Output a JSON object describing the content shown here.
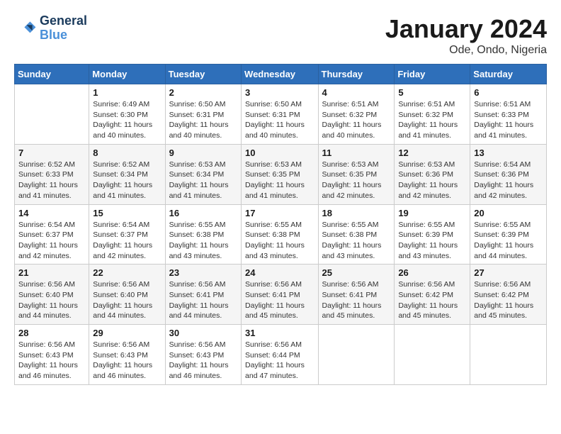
{
  "header": {
    "logo_text_general": "General",
    "logo_text_blue": "Blue",
    "month_title": "January 2024",
    "location": "Ode, Ondo, Nigeria"
  },
  "weekdays": [
    "Sunday",
    "Monday",
    "Tuesday",
    "Wednesday",
    "Thursday",
    "Friday",
    "Saturday"
  ],
  "weeks": [
    [
      {
        "day": "",
        "sunrise": "",
        "sunset": "",
        "daylight": ""
      },
      {
        "day": "1",
        "sunrise": "Sunrise: 6:49 AM",
        "sunset": "Sunset: 6:30 PM",
        "daylight": "Daylight: 11 hours and 40 minutes."
      },
      {
        "day": "2",
        "sunrise": "Sunrise: 6:50 AM",
        "sunset": "Sunset: 6:31 PM",
        "daylight": "Daylight: 11 hours and 40 minutes."
      },
      {
        "day": "3",
        "sunrise": "Sunrise: 6:50 AM",
        "sunset": "Sunset: 6:31 PM",
        "daylight": "Daylight: 11 hours and 40 minutes."
      },
      {
        "day": "4",
        "sunrise": "Sunrise: 6:51 AM",
        "sunset": "Sunset: 6:32 PM",
        "daylight": "Daylight: 11 hours and 40 minutes."
      },
      {
        "day": "5",
        "sunrise": "Sunrise: 6:51 AM",
        "sunset": "Sunset: 6:32 PM",
        "daylight": "Daylight: 11 hours and 41 minutes."
      },
      {
        "day": "6",
        "sunrise": "Sunrise: 6:51 AM",
        "sunset": "Sunset: 6:33 PM",
        "daylight": "Daylight: 11 hours and 41 minutes."
      }
    ],
    [
      {
        "day": "7",
        "sunrise": "Sunrise: 6:52 AM",
        "sunset": "Sunset: 6:33 PM",
        "daylight": "Daylight: 11 hours and 41 minutes."
      },
      {
        "day": "8",
        "sunrise": "Sunrise: 6:52 AM",
        "sunset": "Sunset: 6:34 PM",
        "daylight": "Daylight: 11 hours and 41 minutes."
      },
      {
        "day": "9",
        "sunrise": "Sunrise: 6:53 AM",
        "sunset": "Sunset: 6:34 PM",
        "daylight": "Daylight: 11 hours and 41 minutes."
      },
      {
        "day": "10",
        "sunrise": "Sunrise: 6:53 AM",
        "sunset": "Sunset: 6:35 PM",
        "daylight": "Daylight: 11 hours and 41 minutes."
      },
      {
        "day": "11",
        "sunrise": "Sunrise: 6:53 AM",
        "sunset": "Sunset: 6:35 PM",
        "daylight": "Daylight: 11 hours and 42 minutes."
      },
      {
        "day": "12",
        "sunrise": "Sunrise: 6:53 AM",
        "sunset": "Sunset: 6:36 PM",
        "daylight": "Daylight: 11 hours and 42 minutes."
      },
      {
        "day": "13",
        "sunrise": "Sunrise: 6:54 AM",
        "sunset": "Sunset: 6:36 PM",
        "daylight": "Daylight: 11 hours and 42 minutes."
      }
    ],
    [
      {
        "day": "14",
        "sunrise": "Sunrise: 6:54 AM",
        "sunset": "Sunset: 6:37 PM",
        "daylight": "Daylight: 11 hours and 42 minutes."
      },
      {
        "day": "15",
        "sunrise": "Sunrise: 6:54 AM",
        "sunset": "Sunset: 6:37 PM",
        "daylight": "Daylight: 11 hours and 42 minutes."
      },
      {
        "day": "16",
        "sunrise": "Sunrise: 6:55 AM",
        "sunset": "Sunset: 6:38 PM",
        "daylight": "Daylight: 11 hours and 43 minutes."
      },
      {
        "day": "17",
        "sunrise": "Sunrise: 6:55 AM",
        "sunset": "Sunset: 6:38 PM",
        "daylight": "Daylight: 11 hours and 43 minutes."
      },
      {
        "day": "18",
        "sunrise": "Sunrise: 6:55 AM",
        "sunset": "Sunset: 6:38 PM",
        "daylight": "Daylight: 11 hours and 43 minutes."
      },
      {
        "day": "19",
        "sunrise": "Sunrise: 6:55 AM",
        "sunset": "Sunset: 6:39 PM",
        "daylight": "Daylight: 11 hours and 43 minutes."
      },
      {
        "day": "20",
        "sunrise": "Sunrise: 6:55 AM",
        "sunset": "Sunset: 6:39 PM",
        "daylight": "Daylight: 11 hours and 44 minutes."
      }
    ],
    [
      {
        "day": "21",
        "sunrise": "Sunrise: 6:56 AM",
        "sunset": "Sunset: 6:40 PM",
        "daylight": "Daylight: 11 hours and 44 minutes."
      },
      {
        "day": "22",
        "sunrise": "Sunrise: 6:56 AM",
        "sunset": "Sunset: 6:40 PM",
        "daylight": "Daylight: 11 hours and 44 minutes."
      },
      {
        "day": "23",
        "sunrise": "Sunrise: 6:56 AM",
        "sunset": "Sunset: 6:41 PM",
        "daylight": "Daylight: 11 hours and 44 minutes."
      },
      {
        "day": "24",
        "sunrise": "Sunrise: 6:56 AM",
        "sunset": "Sunset: 6:41 PM",
        "daylight": "Daylight: 11 hours and 45 minutes."
      },
      {
        "day": "25",
        "sunrise": "Sunrise: 6:56 AM",
        "sunset": "Sunset: 6:41 PM",
        "daylight": "Daylight: 11 hours and 45 minutes."
      },
      {
        "day": "26",
        "sunrise": "Sunrise: 6:56 AM",
        "sunset": "Sunset: 6:42 PM",
        "daylight": "Daylight: 11 hours and 45 minutes."
      },
      {
        "day": "27",
        "sunrise": "Sunrise: 6:56 AM",
        "sunset": "Sunset: 6:42 PM",
        "daylight": "Daylight: 11 hours and 45 minutes."
      }
    ],
    [
      {
        "day": "28",
        "sunrise": "Sunrise: 6:56 AM",
        "sunset": "Sunset: 6:43 PM",
        "daylight": "Daylight: 11 hours and 46 minutes."
      },
      {
        "day": "29",
        "sunrise": "Sunrise: 6:56 AM",
        "sunset": "Sunset: 6:43 PM",
        "daylight": "Daylight: 11 hours and 46 minutes."
      },
      {
        "day": "30",
        "sunrise": "Sunrise: 6:56 AM",
        "sunset": "Sunset: 6:43 PM",
        "daylight": "Daylight: 11 hours and 46 minutes."
      },
      {
        "day": "31",
        "sunrise": "Sunrise: 6:56 AM",
        "sunset": "Sunset: 6:44 PM",
        "daylight": "Daylight: 11 hours and 47 minutes."
      },
      {
        "day": "",
        "sunrise": "",
        "sunset": "",
        "daylight": ""
      },
      {
        "day": "",
        "sunrise": "",
        "sunset": "",
        "daylight": ""
      },
      {
        "day": "",
        "sunrise": "",
        "sunset": "",
        "daylight": ""
      }
    ]
  ]
}
